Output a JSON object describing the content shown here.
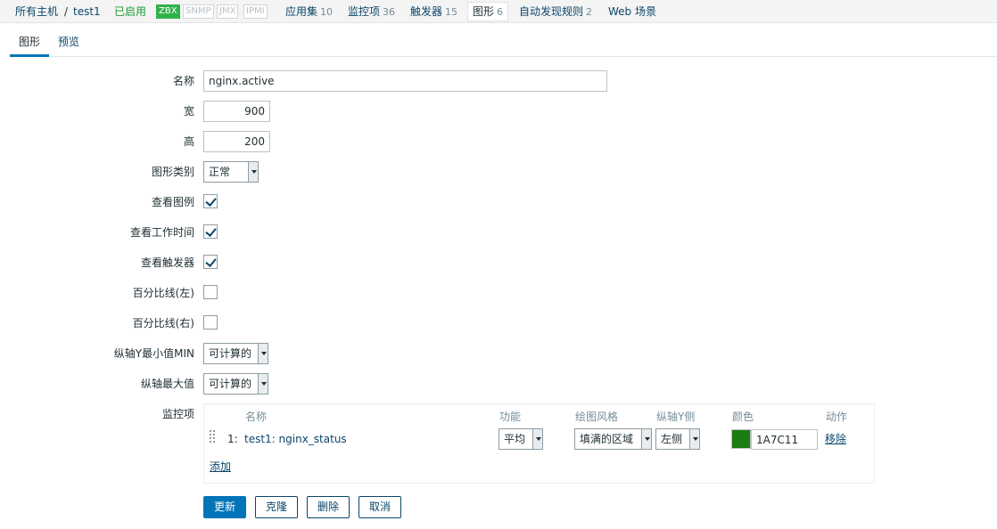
{
  "breadcrumb": {
    "all_hosts": "所有主机",
    "separator": "/",
    "host": "test1",
    "status": "已启用",
    "badges": [
      "ZBX",
      "SNMP",
      "JMX",
      "IPMI"
    ],
    "links": [
      {
        "label": "应用集",
        "count": "10"
      },
      {
        "label": "监控项",
        "count": "36"
      },
      {
        "label": "触发器",
        "count": "15"
      },
      {
        "label": "图形",
        "count": "6"
      },
      {
        "label": "自动发现规则",
        "count": "2"
      },
      {
        "label": "Web 场景",
        "count": ""
      }
    ]
  },
  "tabs": [
    {
      "label": "图形"
    },
    {
      "label": "预览"
    }
  ],
  "form": {
    "name_label": "名称",
    "name_value": "nginx.active",
    "width_label": "宽",
    "width_value": "900",
    "height_label": "高",
    "height_value": "200",
    "graph_type_label": "图形类别",
    "graph_type_value": "正常",
    "show_legend_label": "查看图例",
    "show_legend": true,
    "show_working_time_label": "查看工作时间",
    "show_working_time": true,
    "show_triggers_label": "查看触发器",
    "show_triggers": true,
    "percentile_left_label": "百分比线(左)",
    "percentile_left": false,
    "percentile_right_label": "百分比线(右)",
    "percentile_right": false,
    "ymin_label": "纵轴Y最小值MIN",
    "ymin_value": "可计算的",
    "ymax_label": "纵轴最大值",
    "ymax_value": "可计算的",
    "items_label": "监控项"
  },
  "items_table": {
    "headers": {
      "name": "名称",
      "function": "功能",
      "draw_style": "绘图风格",
      "y_axis_side": "纵轴Y侧",
      "color": "颜色",
      "action": "动作"
    },
    "rows": [
      {
        "index": "1:",
        "name": "test1: nginx_status",
        "function": "平均",
        "draw_style": "填满的区域",
        "y_axis_side": "左侧",
        "color": "1A7C11",
        "color_hex": "#1A7C11",
        "action": "移除"
      }
    ],
    "add_label": "添加"
  },
  "buttons": {
    "update": "更新",
    "clone": "克隆",
    "delete": "删除",
    "cancel": "取消"
  },
  "colors": {
    "accent": "#0275b8",
    "link": "#0a466a",
    "enabled": "#1b9a32",
    "zbx_badge": "#2fb34b"
  }
}
